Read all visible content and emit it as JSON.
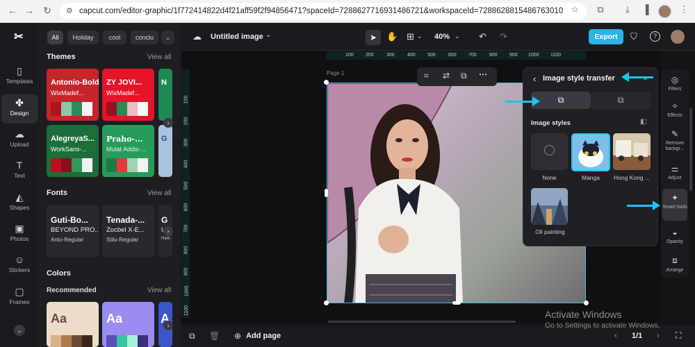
{
  "browser": {
    "url": "capcut.com/editor-graphic/1f772414822d4f21aff59f2f94856471?spaceId=7288627716931486721&workspaceId=7288628815486763010",
    "icons": [
      "back-icon",
      "forward-icon",
      "reload-icon",
      "site-info-icon",
      "bookmark-star-icon",
      "extensions-icon",
      "download-icon",
      "sidebar-icon",
      "menu-icon"
    ]
  },
  "rail": {
    "items": [
      {
        "label": "Templates",
        "icon": "templates-icon"
      },
      {
        "label": "Design",
        "icon": "design-icon"
      },
      {
        "label": "Upload",
        "icon": "upload-icon"
      },
      {
        "label": "Text",
        "icon": "text-icon"
      },
      {
        "label": "Shapes",
        "icon": "shapes-icon"
      },
      {
        "label": "Photos",
        "icon": "photos-icon"
      },
      {
        "label": "Stickers",
        "icon": "stickers-icon"
      },
      {
        "label": "Frames",
        "icon": "frames-icon"
      }
    ]
  },
  "panel": {
    "chips": [
      "All",
      "Holiday",
      "cool",
      "conclu"
    ],
    "themes": {
      "title": "Themes",
      "view_all": "View all",
      "cards": [
        {
          "title": "Antonio-Bold",
          "subtitle": "WixMadef...",
          "bg": "#c4262b",
          "swatches": [
            "#b0131d",
            "#8fc7a4",
            "#2b8c5b",
            "#f4f4f4"
          ]
        },
        {
          "title": "ZY JOVI...",
          "subtitle": "WixMadef...",
          "bg": "#e5142a",
          "swatches": [
            "#9e0f1e",
            "#2a8b59",
            "#f3b8c4",
            "#f7f7f7"
          ]
        },
        {
          "title": "AlegreyaS...",
          "subtitle": "WorkSans-...",
          "bg": "#1c6e3a",
          "swatches": [
            "#b5121f",
            "#8a0f1a",
            "#2e9a57",
            "#f2f2f2"
          ]
        },
        {
          "title": "Praho-...",
          "subtitle": "Mulat Addis-...",
          "bg": "#279b5a",
          "swatches": [
            "#1c7a43",
            "#e23a3d",
            "#9ed4b2",
            "#f3f3f3"
          ]
        }
      ]
    },
    "fonts": {
      "title": "Fonts",
      "view_all": "View all",
      "cards": [
        {
          "line1": "Guti-Bo...",
          "line2": "BEYOND PRO...",
          "line3": "Anto-Regular"
        },
        {
          "line1": "Tenada-...",
          "line2": "Zocbel X-E...",
          "line3": "Stilu-Regular"
        },
        {
          "line1": "G",
          "line2": "Us",
          "line3": "Ham"
        }
      ]
    },
    "colors": {
      "title": "Colors",
      "recommended": "Recommended",
      "view_all": "View all",
      "cards": [
        {
          "sample": "Aa",
          "bg": "#ecdcc9",
          "fg": "#6c4a33",
          "swatches": [
            "#d8b08a",
            "#b07a4e",
            "#6c4a33",
            "#3a261b"
          ]
        },
        {
          "sample": "Aa",
          "bg": "#9a8cf0",
          "fg": "#ffffff",
          "swatches": [
            "#5a4fb8",
            "#36c4a2",
            "#a8f0d8",
            "#3a2f7a"
          ]
        }
      ]
    }
  },
  "topbar": {
    "doc_title": "Untitled image",
    "zoom": "40%",
    "export_label": "Export"
  },
  "canvas": {
    "page_label": "Page 1",
    "ruler_top": [
      "100",
      "200",
      "300",
      "400",
      "500",
      "600",
      "700",
      "800",
      "900",
      "1000",
      "1100"
    ],
    "ruler_left": [
      "100",
      "200",
      "300",
      "400",
      "500",
      "600",
      "700",
      "800",
      "900",
      "1000",
      "1100"
    ]
  },
  "style_panel": {
    "title": "Image style transfer",
    "section": "Image styles",
    "styles": [
      "None",
      "Manga",
      "Hong Kong ...",
      "Oil painting"
    ]
  },
  "tools": [
    {
      "label": "Filters",
      "icon": "filters-icon"
    },
    {
      "label": "Effects",
      "icon": "effects-icon"
    },
    {
      "label": "Remove backgr...",
      "icon": "remove-background-icon"
    },
    {
      "label": "Adjust",
      "icon": "adjust-icon"
    },
    {
      "label": "Smart tools",
      "icon": "smart-tools-icon"
    },
    {
      "label": "Opacity",
      "icon": "opacity-icon"
    },
    {
      "label": "Arrange",
      "icon": "arrange-icon"
    }
  ],
  "bottom": {
    "add_page": "Add page",
    "pager": "1/1"
  },
  "watermark": {
    "line1": "Activate Windows",
    "line2": "Go to Settings to activate Windows."
  },
  "colors": {
    "accent": "#2bb3ea",
    "annotation_arrow": "#19c6f0",
    "selection": "#25c4f0"
  }
}
